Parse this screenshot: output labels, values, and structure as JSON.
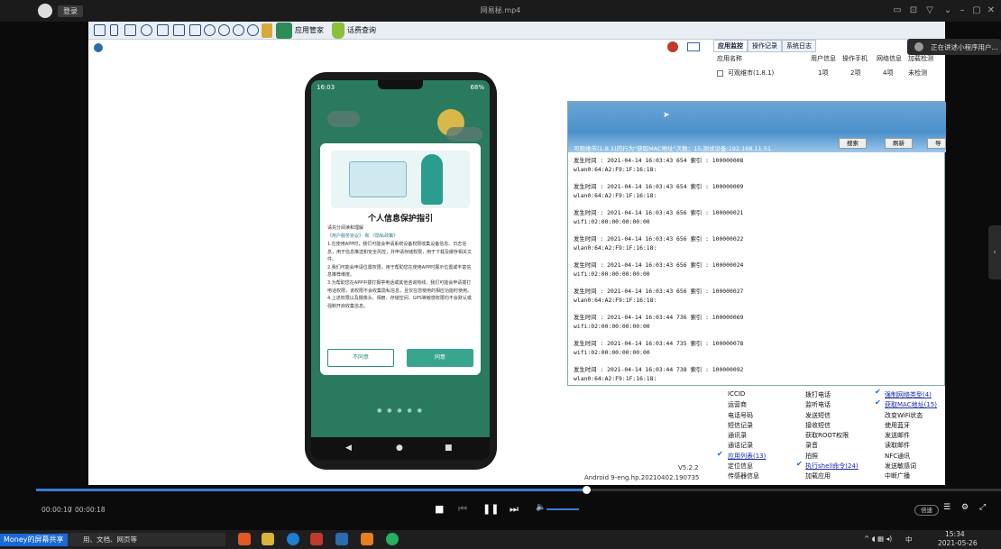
{
  "player": {
    "title": "网易秘.mp4",
    "login": "登录",
    "time_current": "00:00:10",
    "time_sep": "/",
    "time_total": "00:00:18",
    "progress": 0.57,
    "speed": "倍速"
  },
  "toolbar": {
    "app_manager": "应用管家",
    "fee_query": "话费查询"
  },
  "phone": {
    "time": "16:03",
    "battery": "68%",
    "dialog": {
      "title": "个人信息保护指引",
      "subtitle": "请充分阅读和理解",
      "links": "《用户服务协议》 和 《隐私政策》",
      "body": "1.在使用APP时，我们可能会申请系统设备权限收集设备信息、日志信息，用于信息推送和安全风控，并申请存储权限，用于下载及缓存相关文件。\n2.我们可能会申请位置权限，用于帮助您在使用APP时展示位置或丰富信息推荐维度。\n3.为帮助您在APP中拨打报亭电话或其他咨询热线，我们可能会申请拨打电话权限，该权限不会收集隐私信息，且仅在您使用的相应功能时使用。\n4.上述权限以及摄像头、相册、存储空间、GPS等敏感权限均不会默认或强制开启收集信息。",
      "disagree": "不同意",
      "agree": "同意"
    }
  },
  "right_panel": {
    "tabs": [
      "应用监控",
      "操作记录",
      "系统日志"
    ],
    "headers": [
      "应用名称",
      "用户信息",
      "操作手机",
      "网络信息",
      "加载检测"
    ],
    "row": {
      "name": "可观维市(1.8.1)",
      "c1": "1项",
      "c2": "2项",
      "c3": "4项",
      "c4": "未检测"
    },
    "perms_col1": [
      "ICCID",
      "运营商",
      "电话号码",
      "短信记录",
      "通讯录",
      "通话记录",
      "应用列表(13)",
      "定位信息",
      "传感器信息"
    ],
    "perms_col2": [
      "拨打电话",
      "监听电话",
      "发送短信",
      "接收短信",
      "获取ROOT权限",
      "录音",
      "拍照",
      "执行shell命令(24)",
      "加载应用"
    ],
    "perms_col3": [
      "",
      "强制网络类型(4)",
      "获取MAC地址(15)",
      "改变WiFi状态",
      "使用蓝牙",
      "发送邮件",
      "读取邮件",
      "NFC通讯",
      "发送敏感词",
      "中断广播"
    ],
    "version": "V5.2.2",
    "build": "Android 9-eng.hp.20210402.190735"
  },
  "log_window": {
    "title": "可观维市(1.8.1)的行为\"获取MAC地址\"次数：15,测试设备:192.168.11.51",
    "search_btn": "搜索",
    "refresh_btn": "刷新",
    "export_btn": "导出",
    "entries": [
      {
        "line1": "发生时间 : 2021-04-14 16:03:43 654 索引 : 100000008",
        "line2": "wlan0:64:A2:F9:1F:16:18:"
      },
      {
        "line1": "发生时间 : 2021-04-14 16:03:43 654 索引 : 100000009",
        "line2": "wlan0:64:A2:F9:1F:16:18:"
      },
      {
        "line1": "发生时间 : 2021-04-14 16:03:43 656 索引 : 100000021",
        "line2": "wifi:02:00:00:00:00:00"
      },
      {
        "line1": "发生时间 : 2021-04-14 16:03:43 656 索引 : 100000022",
        "line2": "wlan0:64:A2:F9:1F:16:18:"
      },
      {
        "line1": "发生时间 : 2021-04-14 16:03:43 656 索引 : 100000024",
        "line2": "wifi:02:00:00:00:00:00"
      },
      {
        "line1": "发生时间 : 2021-04-14 16:03:43 656 索引 : 100000027",
        "line2": "wlan0:64:A2:F9:1F:16:18:"
      },
      {
        "line1": "发生时间 : 2021-04-14 16:03:44 736 索引 : 100000069",
        "line2": "wifi:02:00:00:00:00:00"
      },
      {
        "line1": "发生时间 : 2021-04-14 16:03:44 735 索引 : 100000078",
        "line2": "wifi:02:00:00:00:00:00"
      },
      {
        "line1": "发生时间 : 2021-04-14 16:03:44 738 索引 : 100000092",
        "line2": "wlan0:64:A2:F9:1F:16:18:"
      }
    ]
  },
  "share_badge": "正在讲述小程序用户...",
  "taskbar": {
    "share_label": "Money的屏幕共享",
    "search_text": "用、文档、网页等",
    "time": "15:34",
    "date": "2021-05-26",
    "ime": "中"
  }
}
